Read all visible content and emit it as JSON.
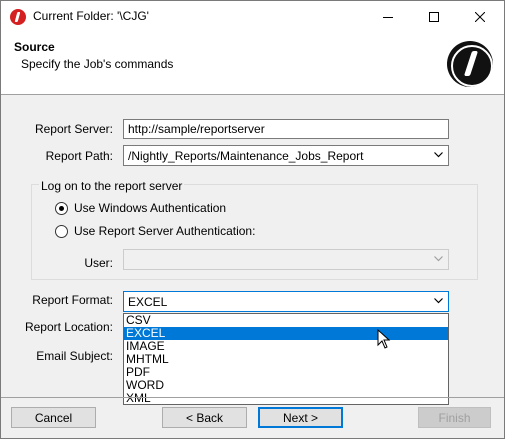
{
  "window": {
    "title": "Current Folder: '\\CJG'"
  },
  "header": {
    "title": "Source",
    "subtitle": "Specify the Job's commands",
    "logo": "job-logo"
  },
  "form": {
    "report_server_label": "Report Server:",
    "report_server_value": "http://sample/reportserver",
    "report_path_label": "Report Path:",
    "report_path_value": "/Nightly_Reports/Maintenance_Jobs_Report",
    "logon_group_label": "Log on to the report server",
    "windows_auth_label": "Use Windows Authentication",
    "windows_auth_checked": true,
    "server_auth_label": "Use Report Server Authentication:",
    "server_auth_checked": false,
    "user_label": "User:",
    "user_value": "",
    "report_format_label": "Report Format:",
    "report_format_value": "EXCEL",
    "report_location_label": "Report Location:",
    "email_subject_label": "Email Subject:"
  },
  "format_dropdown": {
    "options": [
      "CSV",
      "EXCEL",
      "IMAGE",
      "MHTML",
      "PDF",
      "WORD",
      "XML"
    ],
    "highlighted": "EXCEL"
  },
  "footer": {
    "cancel_label": "Cancel",
    "back_label": "< Back",
    "next_label": "Next >",
    "finish_label": "Finish"
  },
  "colors": {
    "accent": "#0078d7",
    "brand_red": "#d42020"
  }
}
